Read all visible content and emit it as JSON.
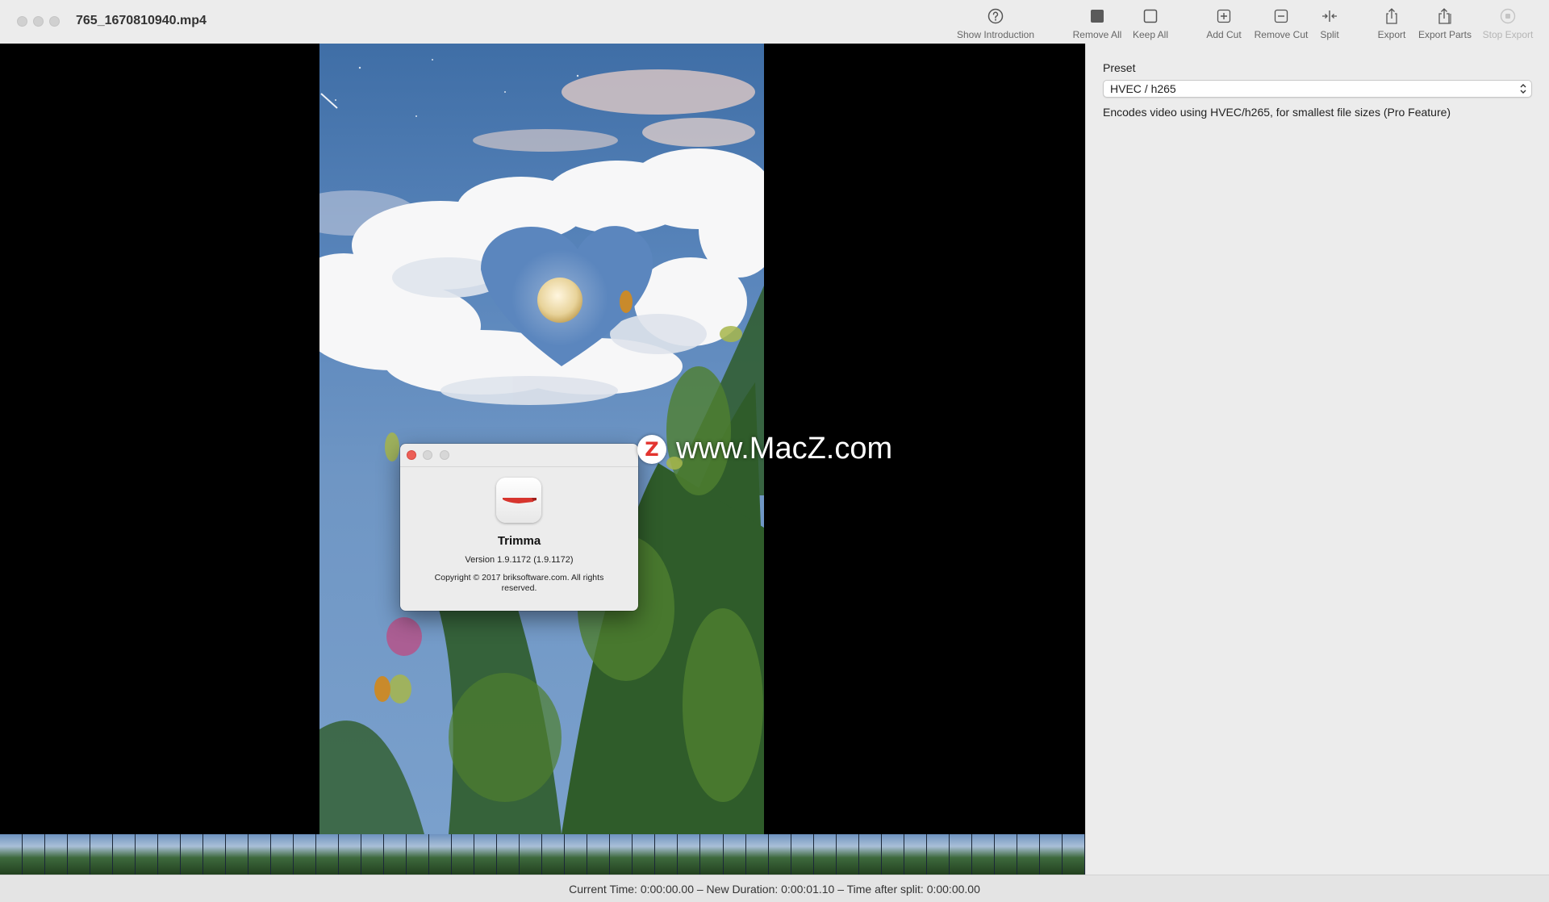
{
  "window": {
    "title": "765_1670810940.mp4"
  },
  "toolbar": {
    "items": [
      {
        "label": "Show Introduction",
        "icon": "question-circle-icon"
      },
      {
        "label": "Remove All",
        "icon": "filled-square-icon"
      },
      {
        "label": "Keep All",
        "icon": "empty-square-icon"
      },
      {
        "label": "Add Cut",
        "icon": "plus-square-icon"
      },
      {
        "label": "Remove Cut",
        "icon": "minus-square-icon"
      },
      {
        "label": "Split",
        "icon": "split-arrows-icon"
      },
      {
        "label": "Export",
        "icon": "share-icon"
      },
      {
        "label": "Export Parts",
        "icon": "share-stack-icon"
      },
      {
        "label": "Stop Export",
        "icon": "stop-circle-icon",
        "disabled": true
      }
    ]
  },
  "sidebar": {
    "preset_label": "Preset",
    "preset_value": "HVEC / h265",
    "preset_description": "Encodes video using HVEC/h265, for smallest file sizes (Pro Feature)"
  },
  "status": {
    "text": "Current Time: 0:00:00.00 – New Duration: 0:00:01.10 – Time after split: 0:00:00.00"
  },
  "about_dialog": {
    "app_name": "Trimma",
    "version": "Version 1.9.1172 (1.9.1172)",
    "copyright": "Copyright © 2017 briksoftware.com. All rights reserved.",
    "close_color": "#ec5f57"
  },
  "watermark": {
    "logo_letter": "Z",
    "text": "www.MacZ.com"
  },
  "colors": {
    "chrome": "#ececec",
    "video_bg": "#000000",
    "sky": "#5a86bc"
  }
}
